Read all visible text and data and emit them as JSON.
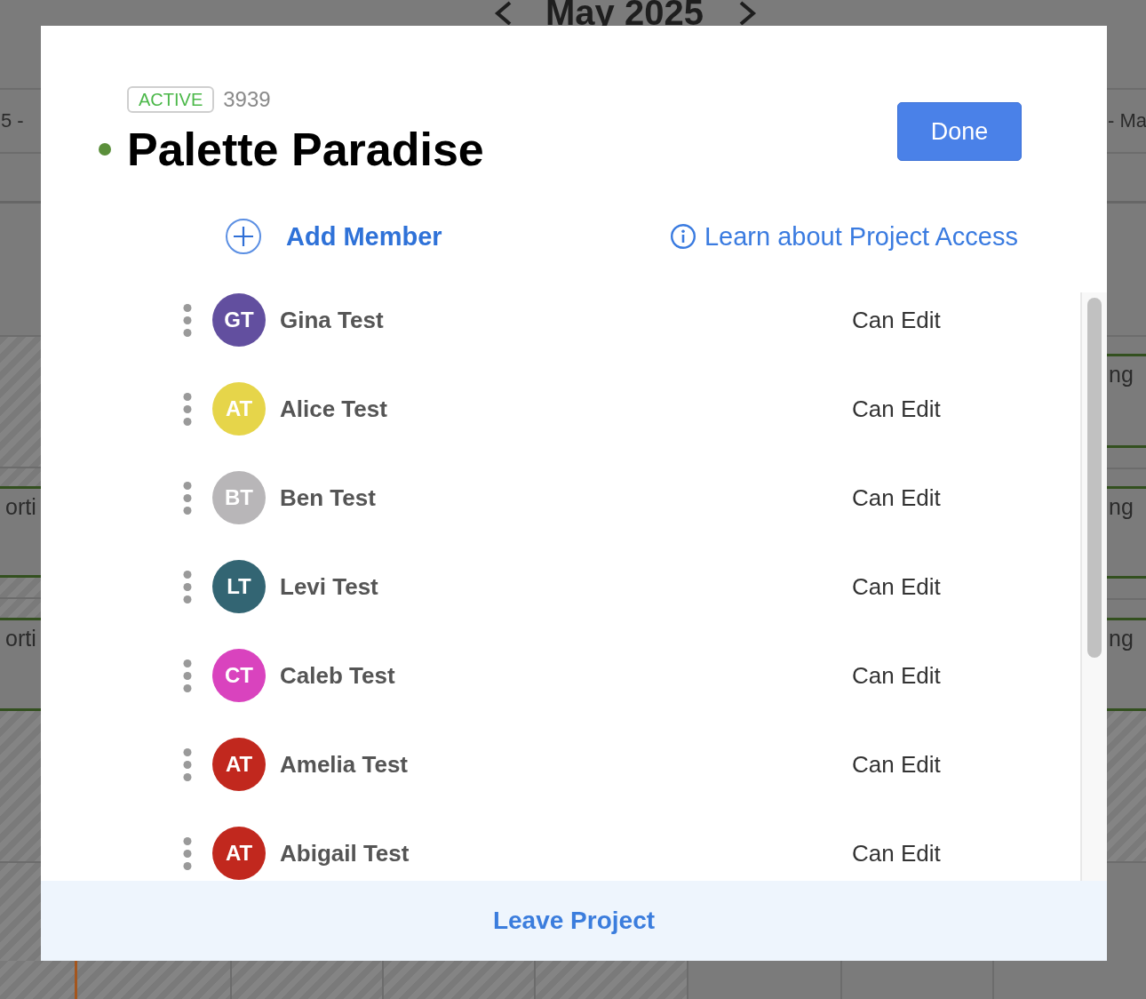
{
  "calendar": {
    "month": "May 2025",
    "left": {
      "week_label": "5 -",
      "events": [
        "orti",
        "orti"
      ]
    },
    "right": {
      "week_label": "- Ma",
      "events": [
        "ng",
        "ng",
        "ng"
      ]
    }
  },
  "dialog": {
    "status": "ACTIVE",
    "project_number": "3939",
    "title": "Palette Paradise",
    "done_button": "Done",
    "add_member": "Add Member",
    "learn_link": "Learn about Project Access",
    "members": [
      {
        "initials": "GT",
        "name": "Gina Test",
        "permission": "Can Edit",
        "color": "#624f9f"
      },
      {
        "initials": "AT",
        "name": "Alice Test",
        "permission": "Can Edit",
        "color": "#e6d54a"
      },
      {
        "initials": "BT",
        "name": "Ben Test",
        "permission": "Can Edit",
        "color": "#b8b6b8"
      },
      {
        "initials": "LT",
        "name": "Levi Test",
        "permission": "Can Edit",
        "color": "#336573"
      },
      {
        "initials": "CT",
        "name": "Caleb Test",
        "permission": "Can Edit",
        "color": "#d943be"
      },
      {
        "initials": "AT",
        "name": "Amelia Test",
        "permission": "Can Edit",
        "color": "#c1281e"
      },
      {
        "initials": "AT",
        "name": "Abigail Test",
        "permission": "Can Edit",
        "color": "#c1281e"
      }
    ],
    "leave_button": "Leave Project"
  }
}
